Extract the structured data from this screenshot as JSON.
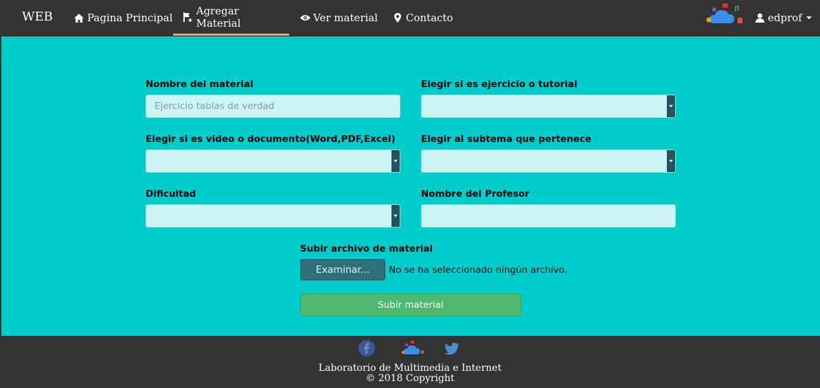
{
  "nav": {
    "brand": "WEB",
    "items": [
      {
        "label": "Pagina Principal",
        "icon": "home-icon"
      },
      {
        "label": "Agregar Material",
        "icon": "flag-plus-icon",
        "active": true
      },
      {
        "label": "Ver material",
        "icon": "eye-icon"
      },
      {
        "label": "Contacto",
        "icon": "map-marker-icon"
      }
    ],
    "user": "edprof",
    "accent_color": "#f0ad4e"
  },
  "form": {
    "name_label": "Nombre del material",
    "name_placeholder": "Ejercicio tablas de verdad",
    "type_label": "Elegir si es ejercicio o tutorial",
    "format_label": "Elegir si es video o documento(Word,PDF,Excel)",
    "subtopic_label": "Elegir al subtema que pertenece",
    "difficulty_label": "Dificultad",
    "teacher_label": "Nombre del Profesor",
    "upload_label": "Subir archivo de material",
    "browse_button": "Examinar...",
    "file_status": "No se ha seleccionado ningún archivo.",
    "submit_button": "Subir material",
    "background_color": "#00cccc",
    "submit_color": "#4cb870"
  },
  "footer": {
    "line1": "Laboratorio de Multimedia e Internet",
    "line2": "© 2018 Copyright",
    "icons": [
      "facebook-icon",
      "cloud-logo-icon",
      "twitter-icon"
    ]
  }
}
